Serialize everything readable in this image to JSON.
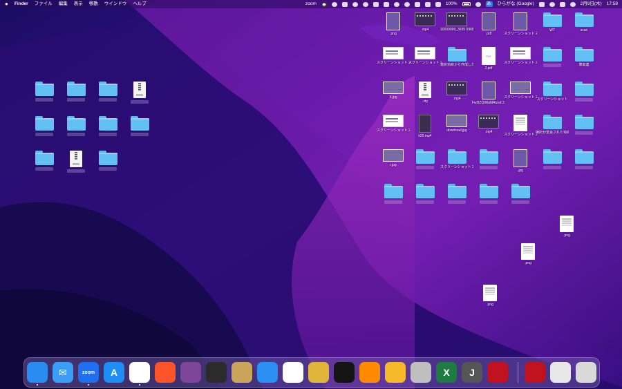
{
  "menubar": {
    "apple": "",
    "app_name": "Finder",
    "menus": [
      "ファイル",
      "編集",
      "表示",
      "移動",
      "ウインドウ",
      "ヘルプ"
    ],
    "status": {
      "zoom": "zoom",
      "battery": "100%",
      "ime": "ひらがな (Google)",
      "date": "2月9日(木)",
      "time": "17:58"
    }
  },
  "desktop": {
    "left_items": [
      {
        "type": "folder",
        "label": ""
      },
      {
        "type": "folder",
        "label": ""
      },
      {
        "type": "folder",
        "label": ""
      },
      {
        "type": "zip",
        "label": ""
      },
      {
        "type": "folder",
        "label": ""
      },
      {
        "type": "folder",
        "label": ""
      },
      {
        "type": "folder",
        "label": ""
      },
      {
        "type": "folder",
        "label": ""
      },
      {
        "type": "folder",
        "label": ""
      },
      {
        "type": "zip",
        "label": ""
      },
      {
        "type": "folder",
        "label": ""
      }
    ],
    "right_items": [
      {
        "type": "png",
        "label": ".png"
      },
      {
        "type": "video",
        "label": ".mp4"
      },
      {
        "type": "video",
        "label": "10000000_3695 096800...._n.mp4"
      },
      {
        "type": "pdf",
        "label": ".pdf"
      },
      {
        "type": "png",
        "label": "スクリーンショット 2021-0....6.47.png"
      },
      {
        "type": "folder",
        "label": "WT"
      },
      {
        "type": "folder",
        "label": "scan"
      },
      {
        "type": "shot",
        "label": "スクリーンショット 2023-0....30.png"
      },
      {
        "type": "shot",
        "label": "スクリーンショット 2022-1....9.42.png"
      },
      {
        "type": "folder",
        "label": "選択項目から作成したフォルダ"
      },
      {
        "type": "pdfw",
        "label": "2.pdf"
      },
      {
        "type": "shot",
        "label": "スクリーンショット 2021-1....9.32.png"
      },
      {
        "type": "folder",
        "label": ""
      },
      {
        "type": "folder",
        "label": "車関連"
      },
      {
        "type": "jpg",
        "label": "X.jpg"
      },
      {
        "type": "zip",
        "label": ".zip"
      },
      {
        "type": "video",
        "label": ".mp4"
      },
      {
        "type": "png",
        "label": "FwDZQtWaMAIzsd 2.jpg"
      },
      {
        "type": "jpg",
        "label": "スクリーンショット 2022-0....34.png"
      },
      {
        "type": "folder",
        "label": "スクリーンショット"
      },
      {
        "type": "folder",
        "label": ""
      },
      {
        "type": "shot",
        "label": "スクリーンショット 2023-0....33.png"
      },
      {
        "type": "tall",
        "label": "k20.mp4"
      },
      {
        "type": "jpg",
        "label": "download.jpg"
      },
      {
        "type": "video",
        "label": ".mp4"
      },
      {
        "type": "doc",
        "label": "スクリーンショット 2022-0....1.25.png"
      },
      {
        "type": "folder",
        "label": "場所が変更された項目.nosync"
      },
      {
        "type": "folder",
        "label": ""
      },
      {
        "type": "jpg",
        "label": "r.jpg"
      },
      {
        "type": "folder",
        "label": ""
      },
      {
        "type": "folder",
        "label": "スクリーンショット 2022-1....2.24.png"
      },
      {
        "type": "folder",
        "label": ""
      },
      {
        "type": "png",
        "label": ".jpg"
      },
      {
        "type": "folder",
        "label": ""
      },
      {
        "type": "folder",
        "label": ""
      },
      {
        "type": "folder",
        "label": ""
      },
      {
        "type": "folder",
        "label": ""
      },
      {
        "type": "folder",
        "label": ""
      },
      {
        "type": "folder",
        "label": ""
      },
      {
        "type": "folder",
        "label": ""
      },
      {
        "type": "doc",
        "label": ".png"
      },
      {
        "type": "doc",
        "label": ".png"
      },
      {
        "type": "doc",
        "label": ".png"
      }
    ]
  },
  "dock": {
    "apps": [
      {
        "name": "finder-app",
        "glyph": "",
        "bg": "#2a8cf0",
        "running": true
      },
      {
        "name": "mail-app",
        "glyph": "✉",
        "bg": "#3b9df5",
        "running": false
      },
      {
        "name": "zoom-app",
        "glyph": "zoom",
        "bg": "#1f6ff0",
        "running": true
      },
      {
        "name": "app-store-app",
        "glyph": "A",
        "bg": "#1c8ef5",
        "running": false
      },
      {
        "name": "chrome-app",
        "glyph": "",
        "bg": "#ffffff",
        "running": true
      },
      {
        "name": "brave-app",
        "glyph": "",
        "bg": "#fb542b",
        "running": false
      },
      {
        "name": "tor-browser-app",
        "glyph": "",
        "bg": "#7d4698",
        "running": false
      },
      {
        "name": "obs-app",
        "glyph": "",
        "bg": "#2b2b2b",
        "running": false
      },
      {
        "name": "podcast-app",
        "glyph": "",
        "bg": "#caa45a",
        "running": false
      },
      {
        "name": "safari-app",
        "glyph": "",
        "bg": "#2a8ff0",
        "running": false
      },
      {
        "name": "evernote-app",
        "glyph": "",
        "bg": "#ffffff",
        "running": false
      },
      {
        "name": "transmit-app",
        "glyph": "",
        "bg": "#e1b43a",
        "running": false
      },
      {
        "name": "network-app",
        "glyph": "",
        "bg": "#151515",
        "running": false
      },
      {
        "name": "vlc-app",
        "glyph": "",
        "bg": "#ff8a00",
        "running": false
      },
      {
        "name": "messages-app",
        "glyph": "",
        "bg": "#f5b92a",
        "running": false
      },
      {
        "name": "activity-monitor-app",
        "glyph": "",
        "bg": "#bfbfbf",
        "running": false
      },
      {
        "name": "excel-app",
        "glyph": "X",
        "bg": "#1f7a43",
        "running": false
      },
      {
        "name": "jedit-app",
        "glyph": "J",
        "bg": "#555555",
        "running": false
      },
      {
        "name": "acrobat-app",
        "glyph": "",
        "bg": "#c1121f",
        "running": false
      }
    ],
    "stacks": [
      {
        "name": "acrobat-doc-stack",
        "glyph": "",
        "bg": "#c1121f"
      },
      {
        "name": "documents-stack",
        "glyph": "",
        "bg": "#e8e8e8"
      },
      {
        "name": "trash-app",
        "glyph": "",
        "bg": "#d9d9d9"
      }
    ]
  }
}
